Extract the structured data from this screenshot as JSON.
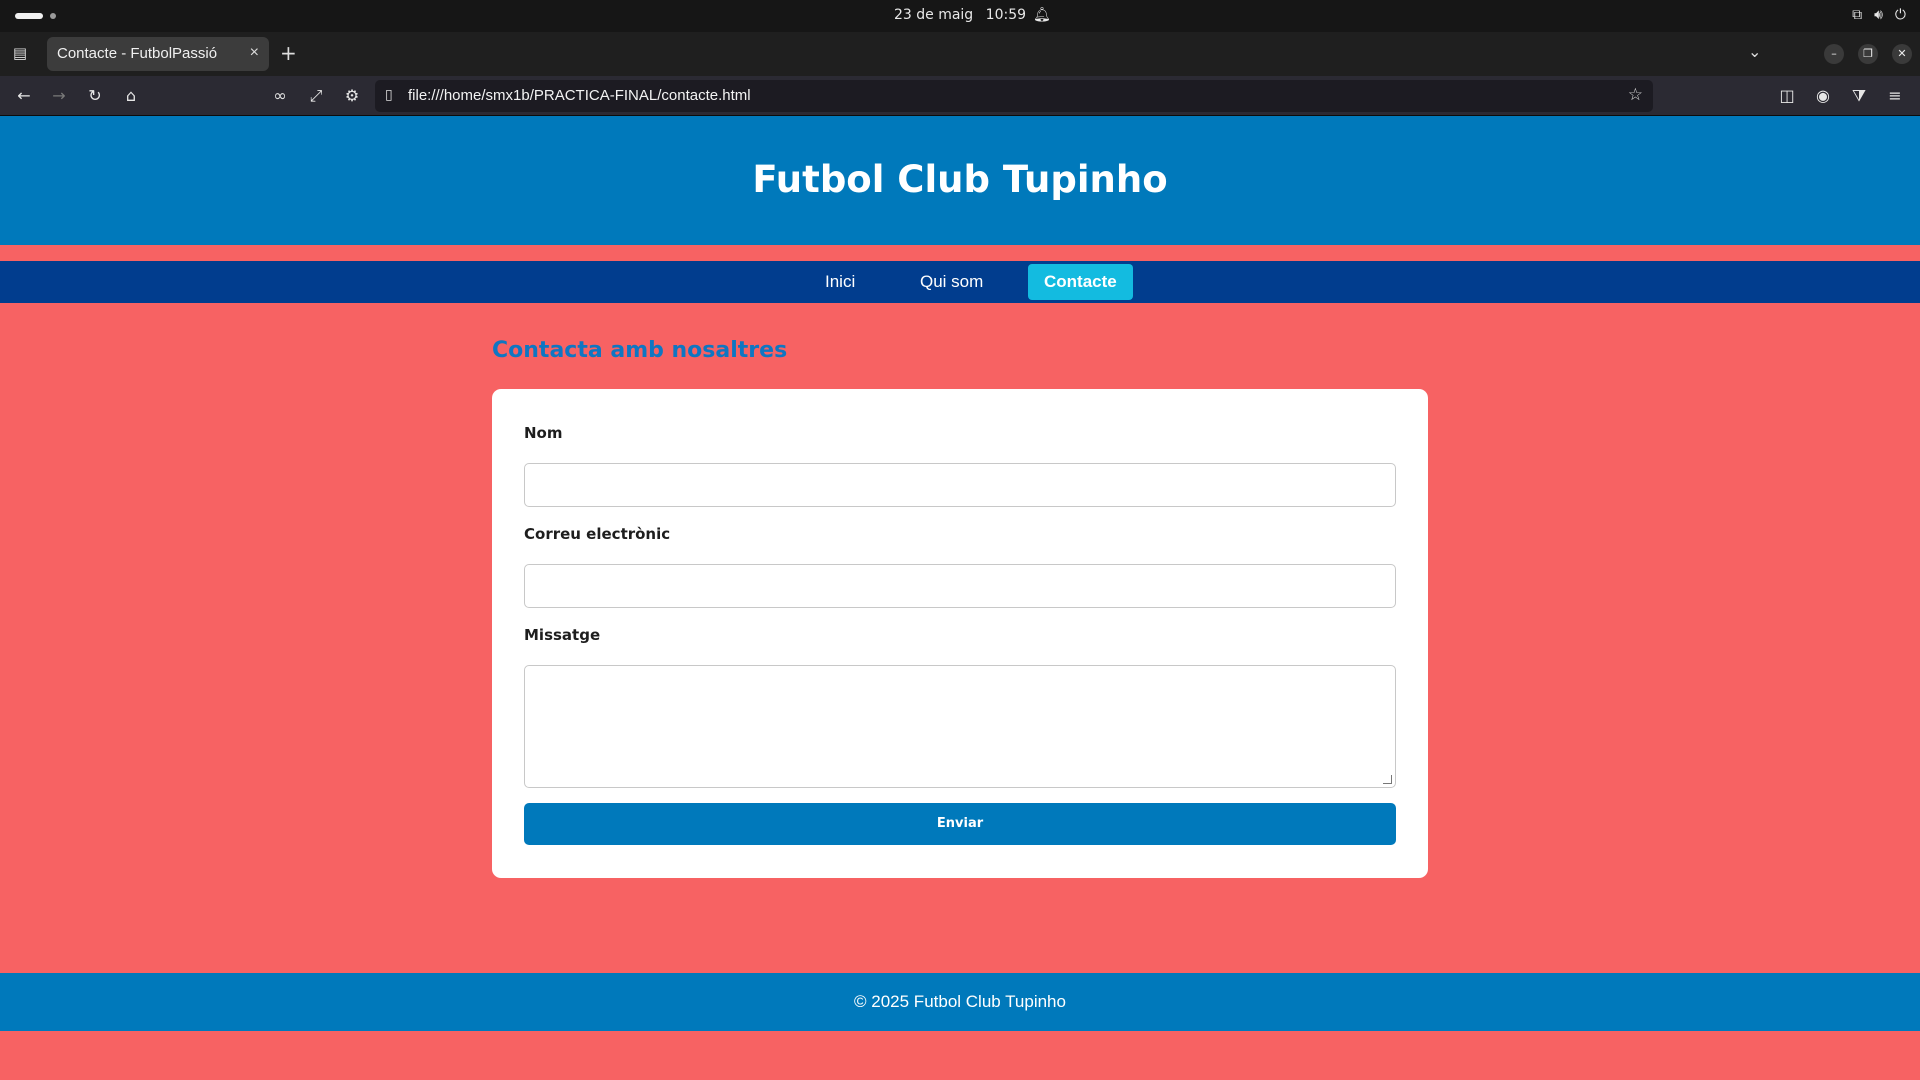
{
  "os": {
    "date": "23 de maig",
    "time": "10:59",
    "icons": [
      "activities-pill",
      "notification-bell-icon",
      "network-icon",
      "volume-icon",
      "power-icon"
    ]
  },
  "browser": {
    "tab_title": "Contacte - FutbolPassió",
    "tab_close": "×",
    "new_tab": "+",
    "url": "file:///home/smx1b/PRACTICA-FINAL/contacte.html",
    "window_controls": [
      "–",
      "❐",
      "✕"
    ]
  },
  "site": {
    "title": "Futbol Club Tupinho",
    "nav": [
      {
        "label": "Inici",
        "active": false
      },
      {
        "label": "Qui som",
        "active": false
      },
      {
        "label": "Contacte",
        "active": true
      }
    ],
    "section_title": "Contacta amb nosaltres",
    "form": {
      "name_label": "Nom",
      "name_value": "",
      "email_label": "Correu electrònic",
      "email_value": "",
      "message_label": "Missatge",
      "message_value": "",
      "submit_label": "Enviar"
    },
    "footer": "© 2025 Futbol Club Tupinho"
  },
  "colors": {
    "page_background": "#f76263",
    "header_blue": "#0079bb",
    "nav_blue": "#013d8e",
    "nav_active": "#13bbe0",
    "heading_blue": "#0f76c2"
  }
}
